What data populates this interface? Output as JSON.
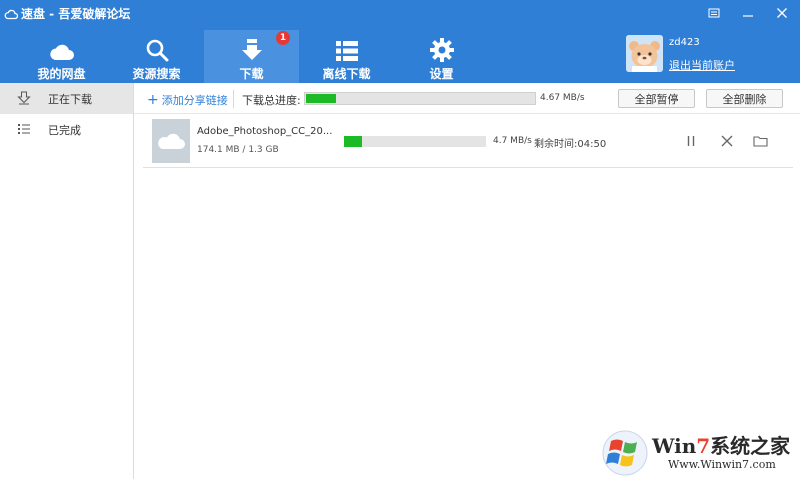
{
  "app": {
    "title": "速盘 - 吾爱破解论坛"
  },
  "nav": [
    {
      "label": "我的网盘",
      "icon": "cloud-icon"
    },
    {
      "label": "资源搜索",
      "icon": "search-icon"
    },
    {
      "label": "下载",
      "icon": "download-icon",
      "badge": "1",
      "active": true
    },
    {
      "label": "离线下载",
      "icon": "list-grid-icon"
    },
    {
      "label": "设置",
      "icon": "gear-icon"
    }
  ],
  "user": {
    "name": "zd423",
    "logout": "退出当前账户"
  },
  "sidebar": [
    {
      "label": "正在下载",
      "icon": "download-arrow-icon",
      "active": true
    },
    {
      "label": "已完成",
      "icon": "list-icon"
    }
  ],
  "toolbar": {
    "add_link": "添加分享链接",
    "total_label": "下载总进度:",
    "total_progress": 0.13,
    "total_speed": "4.67 MB/s",
    "pause_all": "全部暂停",
    "delete_all": "全部删除"
  },
  "downloads": [
    {
      "name": "Adobe_Photoshop_CC_20...",
      "size": "174.1 MB / 1.3 GB",
      "progress": 0.13,
      "speed": "4.7 MB/s",
      "remaining": "剩余时间:04:50"
    }
  ],
  "watermark": {
    "brand_prefix": "Win",
    "brand_digit": "7",
    "brand_suffix": "系统之家",
    "url": "Www.Winwin7.com"
  },
  "colors": {
    "header": "#2f7fd7",
    "active_tab": "#4a92e0",
    "progress": "#1cbb25",
    "badge": "#e53935"
  }
}
